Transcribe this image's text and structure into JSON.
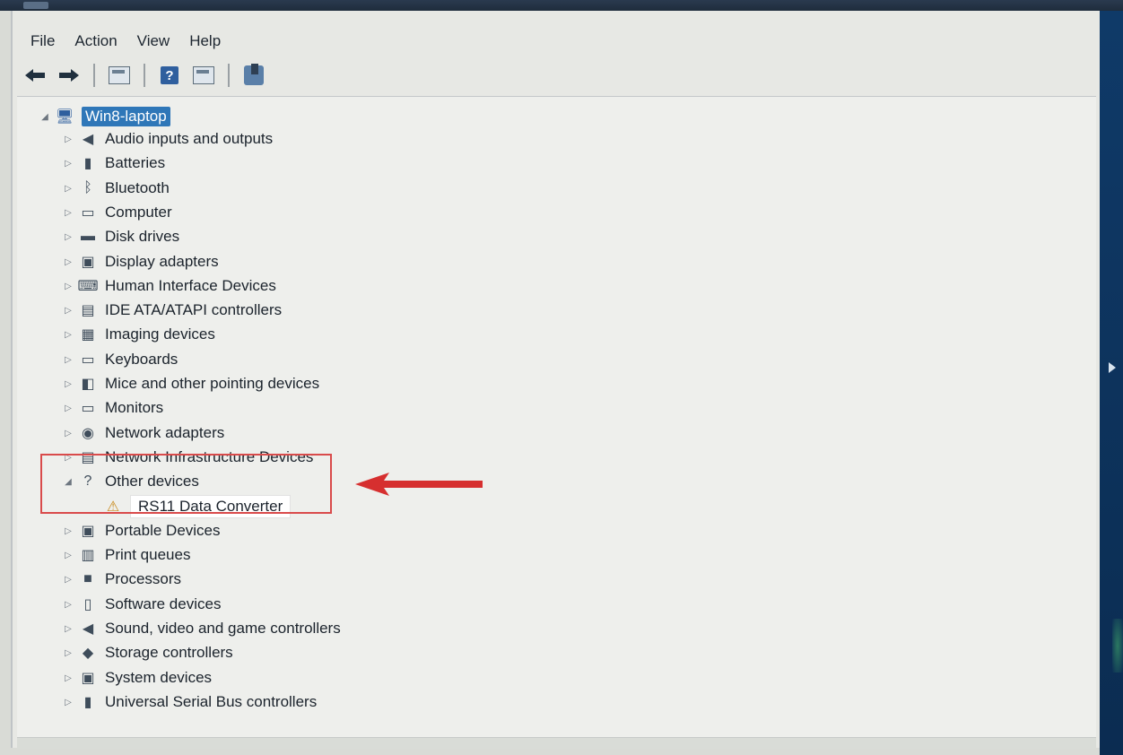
{
  "menubar": {
    "file": "File",
    "action": "Action",
    "view": "View",
    "help": "Help"
  },
  "toolbar": {
    "icons": [
      "back-arrow-icon",
      "forward-arrow-icon",
      "show-hide-console-tree-icon",
      "help-icon",
      "properties-icon",
      "scan-hardware-changes-icon"
    ]
  },
  "tree": {
    "root": {
      "label": "Win8-laptop",
      "icon": "computer-icon",
      "expanded": true
    },
    "categories": [
      {
        "label": "Audio inputs and outputs",
        "icon": "speaker-icon"
      },
      {
        "label": "Batteries",
        "icon": "battery-icon"
      },
      {
        "label": "Bluetooth",
        "icon": "bluetooth-icon"
      },
      {
        "label": "Computer",
        "icon": "monitor-icon"
      },
      {
        "label": "Disk drives",
        "icon": "disk-drive-icon"
      },
      {
        "label": "Display adapters",
        "icon": "display-adapter-icon"
      },
      {
        "label": "Human Interface Devices",
        "icon": "hid-icon"
      },
      {
        "label": "IDE ATA/ATAPI controllers",
        "icon": "ide-controller-icon"
      },
      {
        "label": "Imaging devices",
        "icon": "camera-icon"
      },
      {
        "label": "Keyboards",
        "icon": "keyboard-icon"
      },
      {
        "label": "Mice and other pointing devices",
        "icon": "mouse-icon"
      },
      {
        "label": "Monitors",
        "icon": "monitor-icon"
      },
      {
        "label": "Network adapters",
        "icon": "network-adapter-icon"
      },
      {
        "label": "Network Infrastructure Devices",
        "icon": "network-infra-icon"
      },
      {
        "label": "Other devices",
        "icon": "unknown-device-icon",
        "expanded": true,
        "children": [
          {
            "label": "RS11 Data Converter",
            "icon": "warning-device-icon"
          }
        ]
      },
      {
        "label": "Portable Devices",
        "icon": "portable-device-icon"
      },
      {
        "label": "Print queues",
        "icon": "printer-icon"
      },
      {
        "label": "Processors",
        "icon": "processor-icon"
      },
      {
        "label": "Software devices",
        "icon": "software-device-icon"
      },
      {
        "label": "Sound, video and game controllers",
        "icon": "speaker-icon"
      },
      {
        "label": "Storage controllers",
        "icon": "storage-controller-icon"
      },
      {
        "label": "System devices",
        "icon": "system-device-icon"
      },
      {
        "label": "Universal Serial Bus controllers",
        "icon": "usb-icon"
      }
    ]
  },
  "annotation": {
    "highlight_color": "#d94b4b",
    "arrow_color": "#d62f2f"
  }
}
